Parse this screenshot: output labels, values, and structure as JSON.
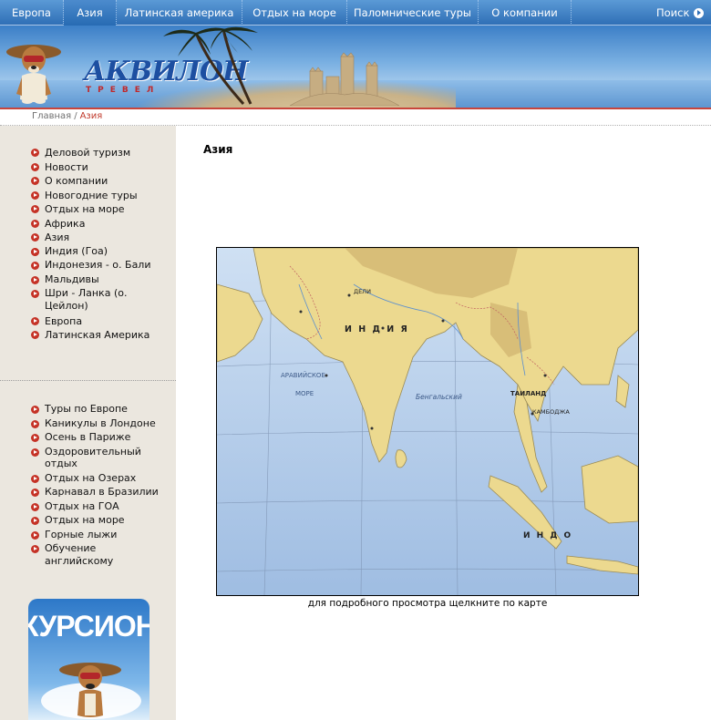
{
  "nav": {
    "items": [
      {
        "label": "Европа"
      },
      {
        "label": "Азия"
      },
      {
        "label": "Латинская америка"
      },
      {
        "label": "Отдых на море"
      },
      {
        "label": "Паломнические туры"
      },
      {
        "label": "О компании"
      }
    ],
    "active_index": 1,
    "search_label": "Поиск"
  },
  "logo": {
    "title": "АКВИЛОН",
    "subtitle": "ТРЕВЕЛ"
  },
  "breadcrumb": {
    "home": "Главная",
    "separator": "/",
    "current": "Азия"
  },
  "sidebar": {
    "menu": [
      {
        "label": "Деловой туризм"
      },
      {
        "label": "Новости"
      },
      {
        "label": "О компании"
      },
      {
        "label": "Новогодние туры"
      },
      {
        "label": "Отдых на море"
      },
      {
        "label": "Африка"
      },
      {
        "label": "Азия"
      },
      {
        "label": "Европа"
      },
      {
        "label": "Латинская Америка"
      }
    ],
    "asia_submenu": [
      {
        "label": "Индия (Гоа)"
      },
      {
        "label": "Индонезия - о. Бали"
      },
      {
        "label": "Мальдивы"
      },
      {
        "label": "Шри - Ланка (о. Цейлон)"
      }
    ],
    "tours": [
      {
        "label": "Туры по Европе"
      },
      {
        "label": "Каникулы в Лондоне"
      },
      {
        "label": "Осень в Париже"
      },
      {
        "label": "Оздоровительный отдых"
      },
      {
        "label": "Отдых на Озерах"
      },
      {
        "label": "Карнавал в Бразилии"
      },
      {
        "label": "Отдых на ГОА"
      },
      {
        "label": "Отдых на море"
      },
      {
        "label": "Горные лыжи"
      },
      {
        "label": "Обучение английскому"
      }
    ],
    "promo_text": "КУРСИОН"
  },
  "main": {
    "title": "Азия",
    "map_labels": {
      "india": "И Н Д И Я",
      "arabian_sea_1": "АРАВИЙСКОЕ",
      "arabian_sea_2": "МОРЕ",
      "bengal": "Бенгальский",
      "thailand": "ТАИЛАНД",
      "cambodia": "КАМБОДЖА",
      "indo": "И Н Д О",
      "delhi": "ДЕЛИ"
    },
    "map_caption": "для подробного просмотра щелкните по карте"
  },
  "colors": {
    "nav_bg": "#3a7cc2",
    "accent_red": "#c53226",
    "sidebar_bg": "#ebe7df",
    "sea": "#bcd4ee",
    "land": "#ecd98f"
  }
}
